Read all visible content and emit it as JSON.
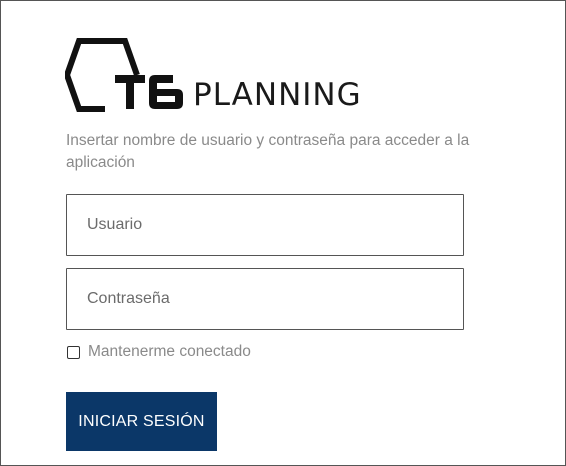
{
  "logo": {
    "mark_text": "T6",
    "word_text": "PLANNING",
    "icon": "hexagon-logo-icon"
  },
  "instructions": "Insertar nombre de usuario y contraseña para acceder a la aplicación",
  "username": {
    "placeholder": "Usuario",
    "value": ""
  },
  "password": {
    "placeholder": "Contraseña",
    "value": ""
  },
  "remember": {
    "label": "Mantenerme conectado",
    "checked": false
  },
  "submit": {
    "label": "INICIAR SESIÓN"
  },
  "colors": {
    "button_bg": "#0b3768",
    "button_text": "#ffffff",
    "muted_text": "#8a8a8a",
    "border": "#555555"
  }
}
